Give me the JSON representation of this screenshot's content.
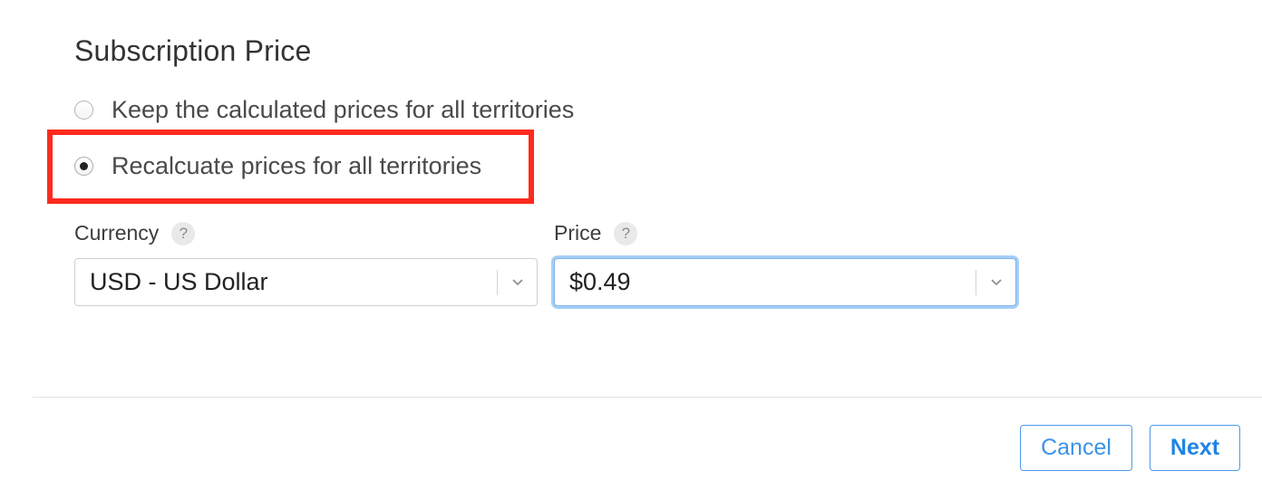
{
  "section": {
    "title": "Subscription Price"
  },
  "options": [
    {
      "label": "Keep the calculated prices for all territories",
      "selected": false
    },
    {
      "label": "Recalcuate prices for all territories",
      "selected": true
    }
  ],
  "currency": {
    "label": "Currency",
    "help": "?",
    "value": "USD - US Dollar"
  },
  "price": {
    "label": "Price",
    "help": "?",
    "value": "$0.49"
  },
  "actions": {
    "cancel_label": "Cancel",
    "next_label": "Next"
  },
  "colors": {
    "accent": "#2a8be6",
    "highlight": "#ff2a1e",
    "focus_ring": "#a6cff5"
  },
  "icons": {
    "chevron": "chevron-down-icon",
    "help": "help-icon"
  }
}
